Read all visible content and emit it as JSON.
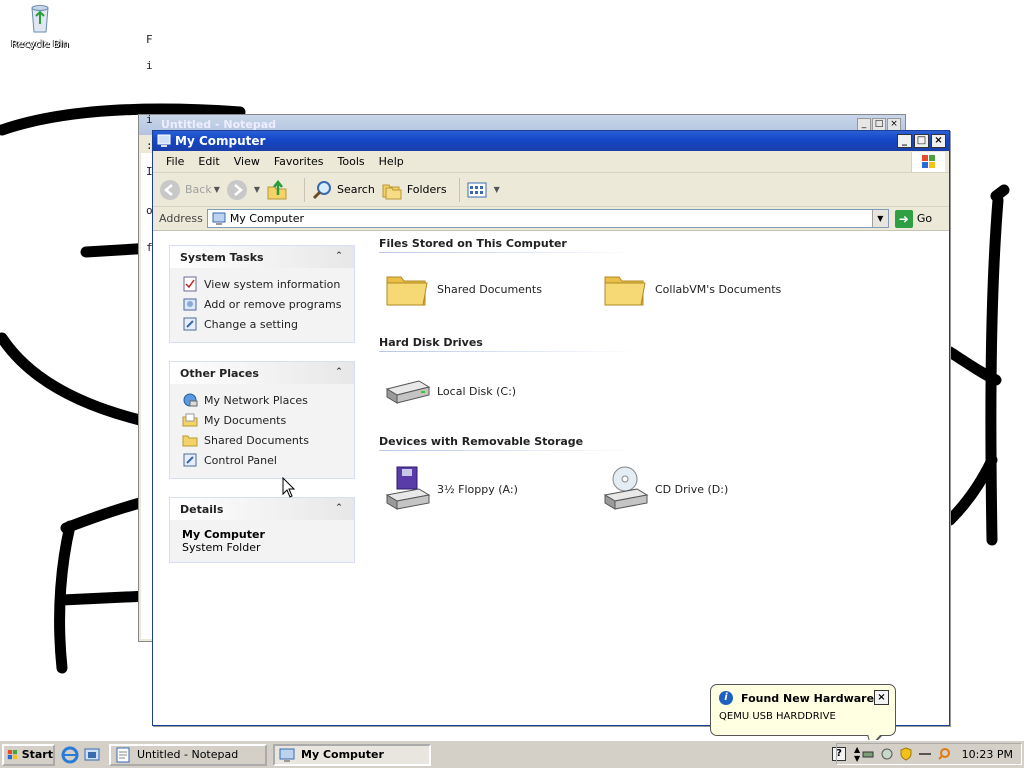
{
  "desktop": {
    "recycle_bin_label": "Recycle Bin"
  },
  "notepad": {
    "title": "Untitled - Notepad",
    "partial_chars": [
      "F",
      "i",
      "i",
      ":",
      "I",
      "o",
      "f"
    ]
  },
  "window": {
    "title": "My Computer",
    "menu": [
      "File",
      "Edit",
      "View",
      "Favorites",
      "Tools",
      "Help"
    ],
    "toolbar": {
      "back": "Back",
      "search": "Search",
      "folders": "Folders"
    },
    "address": {
      "label": "Address",
      "value": "My Computer",
      "go": "Go"
    }
  },
  "left_panel": {
    "system_tasks": {
      "title": "System Tasks",
      "items": [
        "View system information",
        "Add or remove programs",
        "Change a setting"
      ]
    },
    "other_places": {
      "title": "Other Places",
      "items": [
        "My Network Places",
        "My Documents",
        "Shared Documents",
        "Control Panel"
      ]
    },
    "details": {
      "title": "Details",
      "name": "My Computer",
      "type": "System Folder"
    }
  },
  "groups": {
    "files": {
      "title": "Files Stored on This Computer",
      "items": [
        "Shared Documents",
        "CollabVM's Documents"
      ]
    },
    "hdd": {
      "title": "Hard Disk Drives",
      "items": [
        "Local Disk (C:)"
      ]
    },
    "removable": {
      "title": "Devices with Removable Storage",
      "items": [
        "3½ Floppy (A:)",
        "CD Drive (D:)"
      ]
    }
  },
  "taskbar": {
    "start": "Start",
    "buttons": [
      "Untitled - Notepad",
      "My Computer"
    ],
    "clock": "10:23 PM"
  },
  "balloon": {
    "title": "Found New Hardware",
    "message": "QEMU USB HARDDRIVE"
  },
  "colors": {
    "titlebar": "#1446c6",
    "taskbar": "#d4d0c8",
    "balloon_bg": "#ffffe1",
    "folder": "#f4d26a"
  }
}
